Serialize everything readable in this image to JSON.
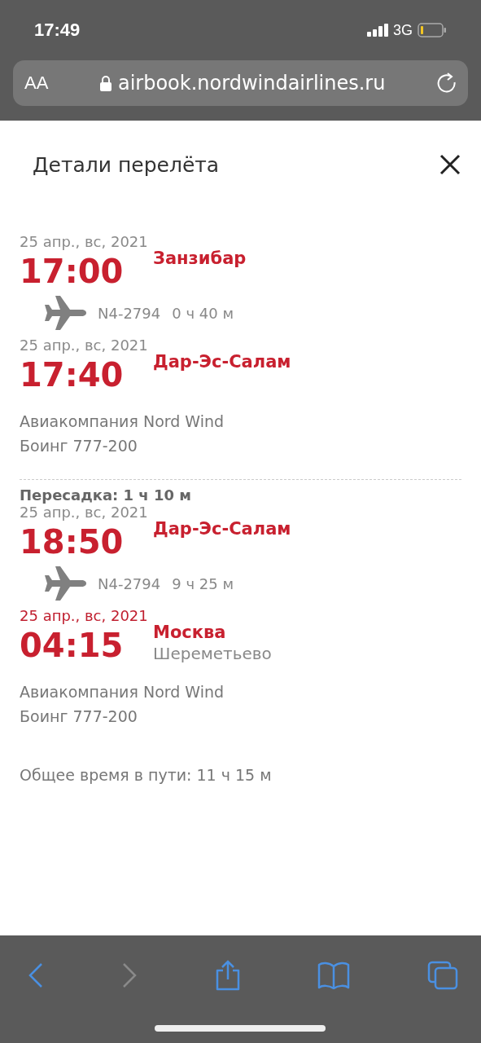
{
  "status_bar": {
    "time": "17:49",
    "network": "3G",
    "battery_low": true
  },
  "address_bar": {
    "text_size_button": "AA",
    "url": "airbook.nordwindairlines.ru",
    "secure": true
  },
  "dialog": {
    "title": "Детали перелёта",
    "legs": [
      {
        "departure": {
          "date": "25 апр., вс, 2021",
          "date_highlighted": false,
          "time": "17:00",
          "city": "Занзибар"
        },
        "flight": "N4-2794",
        "duration": "0 ч 40 м",
        "arrival": {
          "date": "25 апр., вс, 2021",
          "date_highlighted": false,
          "time": "17:40",
          "city": "Дар-Эс-Салам"
        },
        "airline": "Авиакомпания Nord Wind",
        "aircraft": "Боинг 777-200"
      },
      {
        "transfer": "Пересадка: 1 ч 10 м",
        "departure": {
          "date": "25 апр., вс, 2021",
          "date_highlighted": false,
          "time": "18:50",
          "city": "Дар-Эс-Салам"
        },
        "flight": "N4-2794",
        "duration": "9 ч 25 м",
        "arrival": {
          "date": "25 апр., вс, 2021",
          "date_highlighted": true,
          "time": "04:15",
          "city": "Москва",
          "airport": "Шереметьево"
        },
        "airline": "Авиакомпания Nord Wind",
        "aircraft": "Боинг 777-200"
      }
    ],
    "total": "Общее время в пути: 11 ч 15 м"
  },
  "toolbar": {
    "back_enabled": true,
    "forward_enabled": false
  }
}
